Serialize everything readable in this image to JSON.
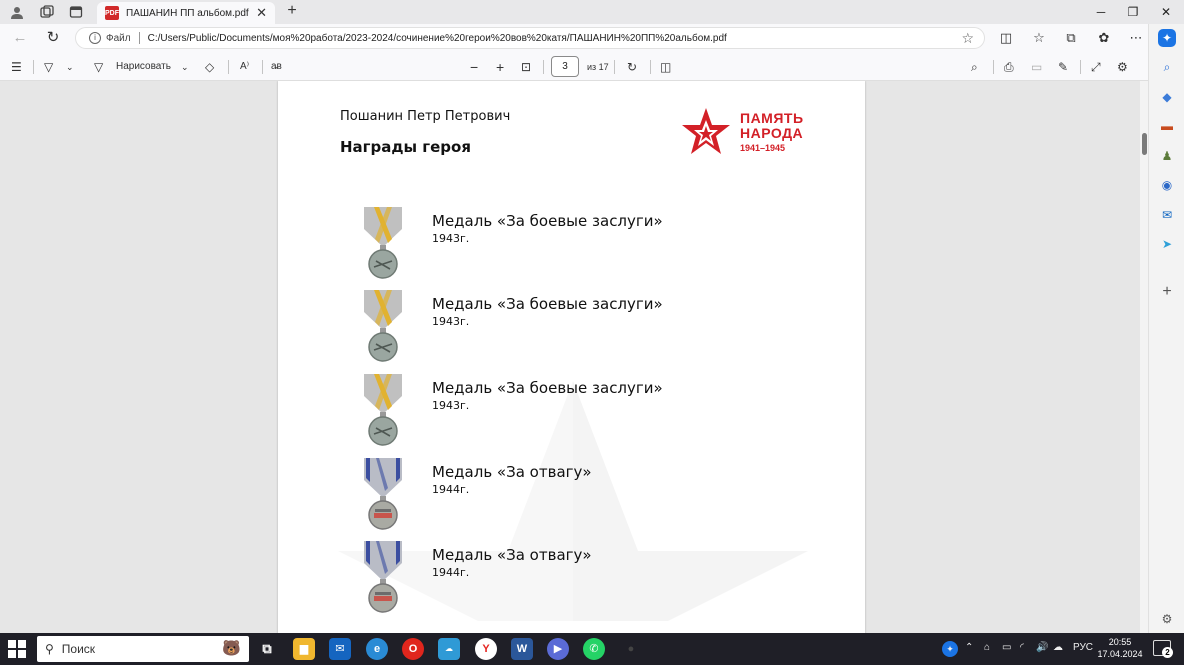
{
  "browser": {
    "tab_title": "ПАШАНИН ПП альбом.pdf",
    "tab_badge": "PDF",
    "address_scheme": "Файл",
    "address_url": "C:/Users/Public/Documents/моя%20работа/2023-2024/сочинение%20герои%20вов%20катя/ПАШАНИН%20ПП%20альбом.pdf"
  },
  "pdf_toolbar": {
    "draw_label": "Нарисовать",
    "read_aloud_label": "A⁾",
    "translate_label": "a̵в",
    "current_page": "3",
    "page_count_label": "из 17"
  },
  "document": {
    "hero_name": "Пошанин Петр Петрович",
    "section_title": "Награды героя",
    "logo": {
      "line1": "ПАМЯТЬ",
      "line2": "НАРОДА",
      "years": "1941–1945",
      "color": "#d32027"
    },
    "awards": [
      {
        "name": "Медаль «За боевые заслуги»",
        "year": "1943г.",
        "ribbon": "gold"
      },
      {
        "name": "Медаль «За боевые заслуги»",
        "year": "1943г.",
        "ribbon": "gold"
      },
      {
        "name": "Медаль «За боевые заслуги»",
        "year": "1943г.",
        "ribbon": "gold"
      },
      {
        "name": "Медаль «За отвагу»",
        "year": "1944г.",
        "ribbon": "blue"
      },
      {
        "name": "Медаль «За отвагу»",
        "year": "1944г.",
        "ribbon": "blue"
      }
    ]
  },
  "taskbar": {
    "search_placeholder": "Поиск",
    "language": "РУС",
    "time": "20:55",
    "date": "17.04.2024",
    "notification_count": "2"
  }
}
